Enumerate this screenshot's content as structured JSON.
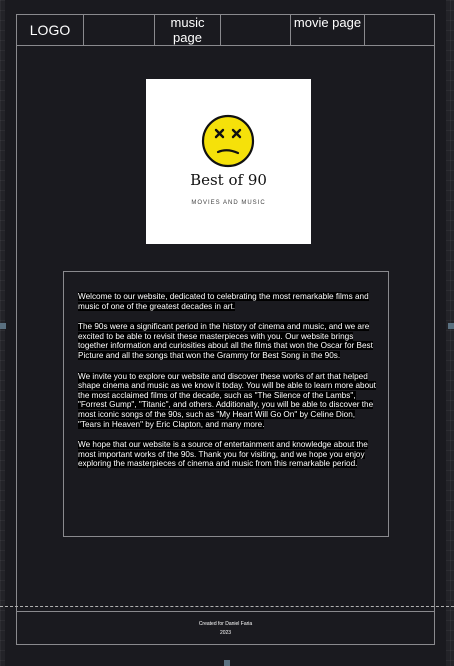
{
  "navbar": {
    "logo": "LOGO",
    "music_link": "music page",
    "movie_link": "movie page"
  },
  "hero": {
    "logo_icon": "dizzy-face-icon",
    "logo_title": "Best of 90",
    "logo_subtitle": "MOVIES AND MUSIC"
  },
  "content": {
    "paragraphs": [
      "Welcome to our website, dedicated to celebrating the most remarkable films and music of one of the greatest decades in art.",
      "The 90s were a significant period in the history of cinema and music, and we are excited to be able to revisit these masterpieces with you. Our website brings together information and curiosities about all the films that won the Oscar for Best Picture and all the songs that won the Grammy for Best Song in the 90s.",
      "We invite you to explore our website and discover these works of art that helped shape cinema and music as we know it today. You will be able to learn more about the most acclaimed films of the decade, such as \"The Silence of the Lambs\", \"Forrest Gump\", \"Titanic\", and others. Additionally, you will be able to discover the most iconic songs of the 90s, such as \"My Heart Will Go On\" by Celine Dion, \"Tears in Heaven\" by Eric Clapton, and many more.",
      "We hope that our website is a source of entertainment and knowledge about the most important works of the 90s. Thank you for visiting, and we hope you enjoy exploring the masterpieces of cinema and music from this remarkable period."
    ]
  },
  "footer": {
    "credit": "Created for Daniel Faria",
    "year": "2023"
  },
  "colors": {
    "canvas": "#232328",
    "page": "#1a1a1f",
    "border": "#8a8a8e",
    "logo_face": "#f5e10a"
  }
}
